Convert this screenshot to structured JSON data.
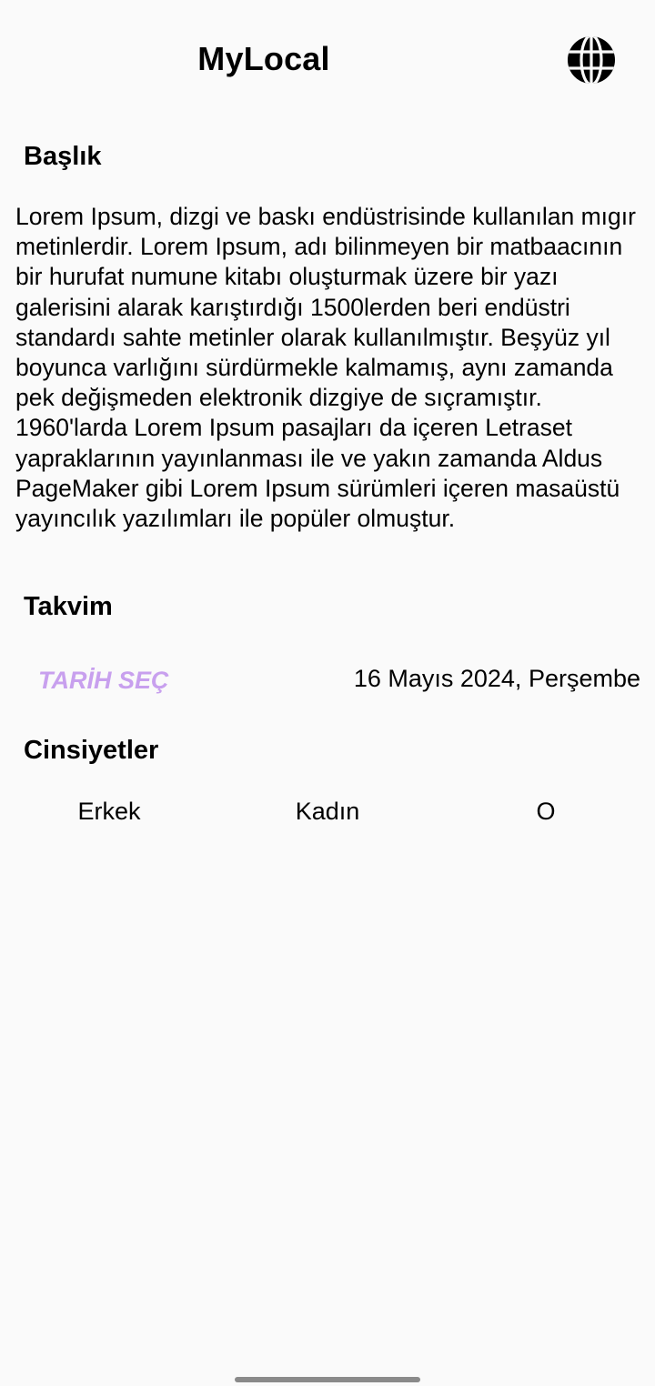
{
  "app_bar": {
    "title": "MyLocal",
    "language_icon": "globe-icon"
  },
  "sections": {
    "title_heading": "Başlık",
    "body_text": "Lorem Ipsum, dizgi ve baskı endüstrisinde kullanılan mıgır metinlerdir. Lorem Ipsum, adı bilinmeyen bir matbaacının bir hurufat numune kitabı oluşturmak üzere bir yazı galerisini alarak karıştırdığı 1500lerden beri endüstri standardı sahte metinler olarak kullanılmıştır. Beşyüz yıl boyunca varlığını sürdürmekle kalmamış, aynı zamanda pek değişmeden elektronik dizgiye de sıçramıştır. 1960'larda Lorem Ipsum pasajları da içeren Letraset yapraklarının yayınlanması ile ve yakın zamanda Aldus PageMaker gibi Lorem Ipsum sürümleri içeren masaüstü yayıncılık yazılımları ile popüler olmuştur.",
    "calendar_heading": "Takvim",
    "genders_heading": "Cinsiyetler"
  },
  "calendar": {
    "pick_date_label": "TARİH SEÇ",
    "selected_date": "16 Mayıs 2024, Perşembe",
    "accent_color": "#c8a0ee"
  },
  "genders": {
    "options": [
      "Erkek",
      "Kadın",
      "O"
    ]
  }
}
